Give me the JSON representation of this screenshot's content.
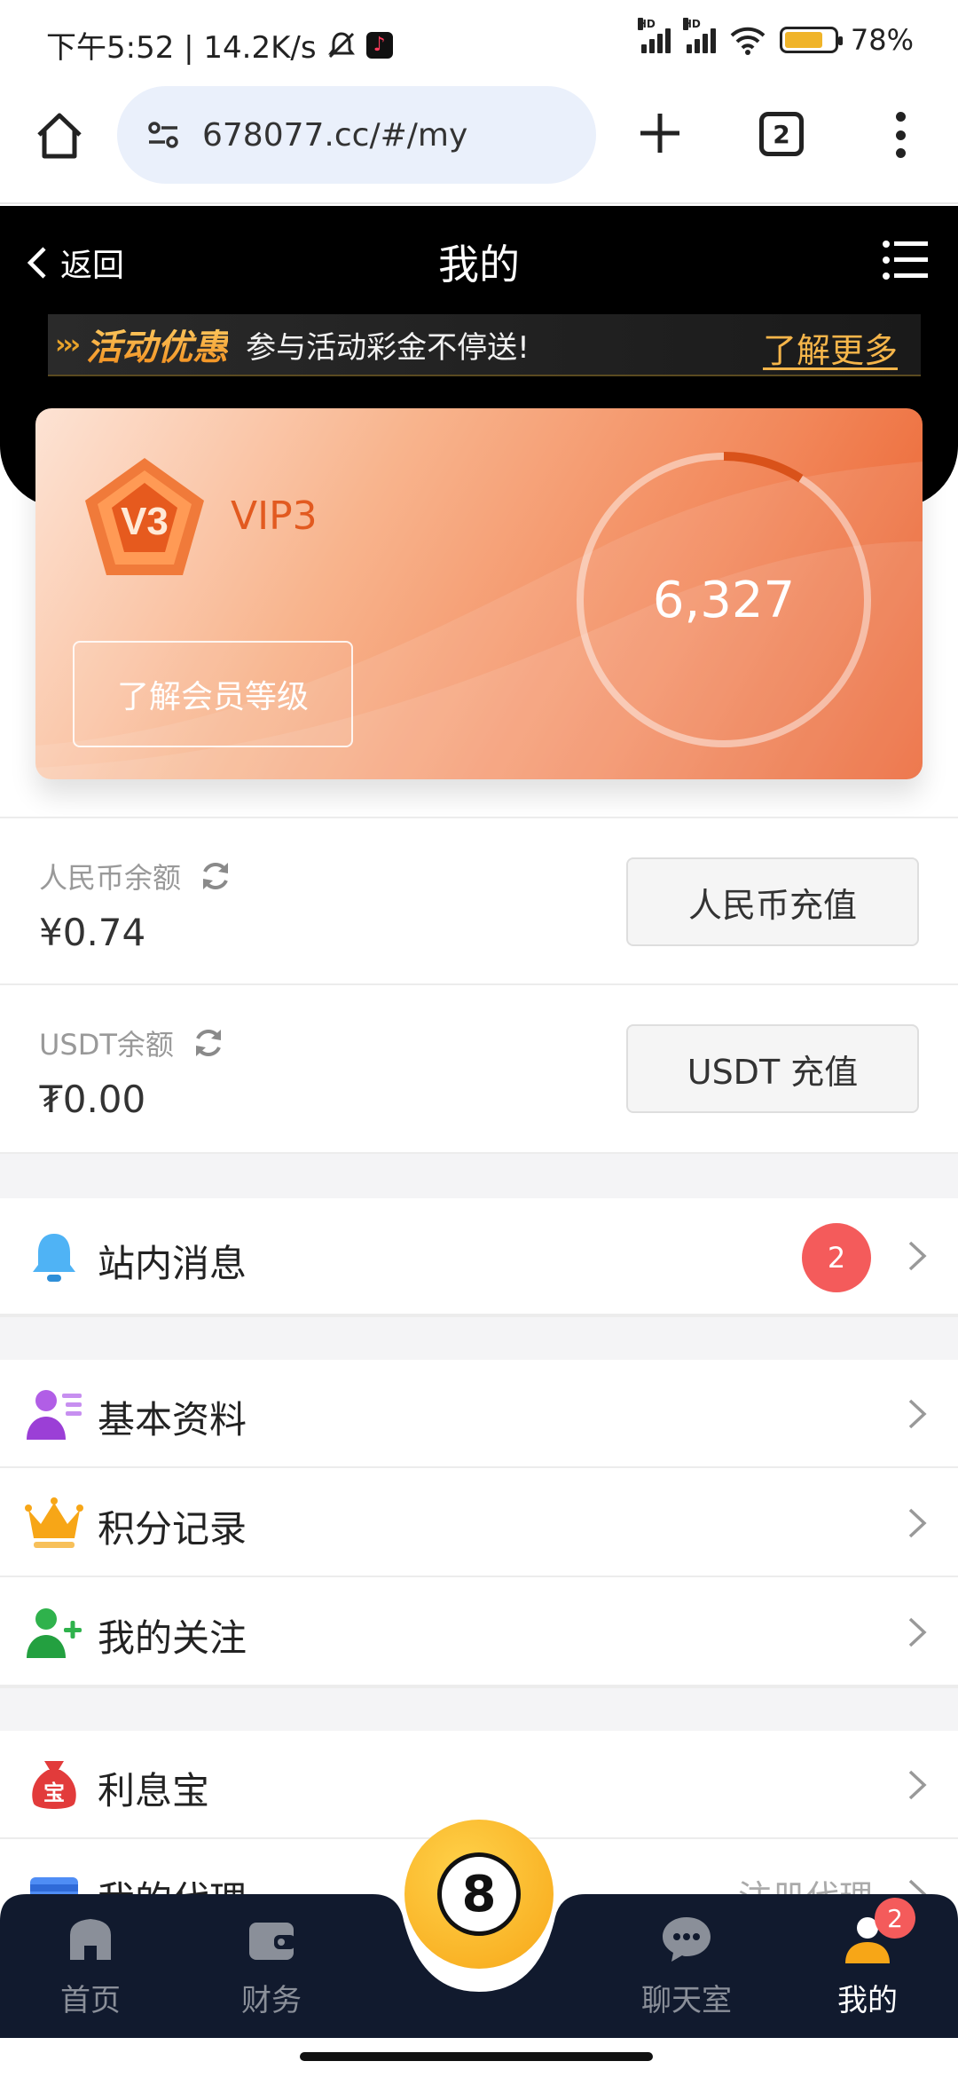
{
  "status_bar": {
    "time_speed": "下午5:52 | 14.2K/s",
    "tiktok_icon": "tiktok-icon",
    "battery": "78%",
    "battery_level": 0.78
  },
  "browser": {
    "url": "678077.cc/#/my",
    "tab_count": "2"
  },
  "header": {
    "back_label": "返回",
    "title": "我的"
  },
  "promo": {
    "tag": "活动优惠",
    "text": "参与活动彩金不停送!",
    "more": "了解更多"
  },
  "vip": {
    "level_badge": "V3",
    "level_name": "VIP3",
    "member_button": "了解会员等级",
    "points": "6,327",
    "progress": 0.09
  },
  "balances": [
    {
      "label": "人民币余额",
      "amount": "¥0.74",
      "button": "人民币充值"
    },
    {
      "label": "USDT余额",
      "amount": "₮0.00",
      "button": "USDT 充值"
    }
  ],
  "menu": {
    "messages": {
      "label": "站内消息",
      "badge": "2"
    },
    "profile": {
      "label": "基本资料"
    },
    "points": {
      "label": "积分记录"
    },
    "follow": {
      "label": "我的关注"
    },
    "interest": {
      "label": "利息宝"
    },
    "agent": {
      "label": "我的代理",
      "extra": "注册代理"
    }
  },
  "bottom_nav": {
    "home": "首页",
    "finance": "财务",
    "center": "8",
    "chat": "聊天室",
    "mine": "我的",
    "mine_badge": "2"
  },
  "colors": {
    "accent": "#f2875a",
    "badge": "#f45b5b",
    "nav_bg": "#111a2e",
    "gold": "#f7a617"
  }
}
